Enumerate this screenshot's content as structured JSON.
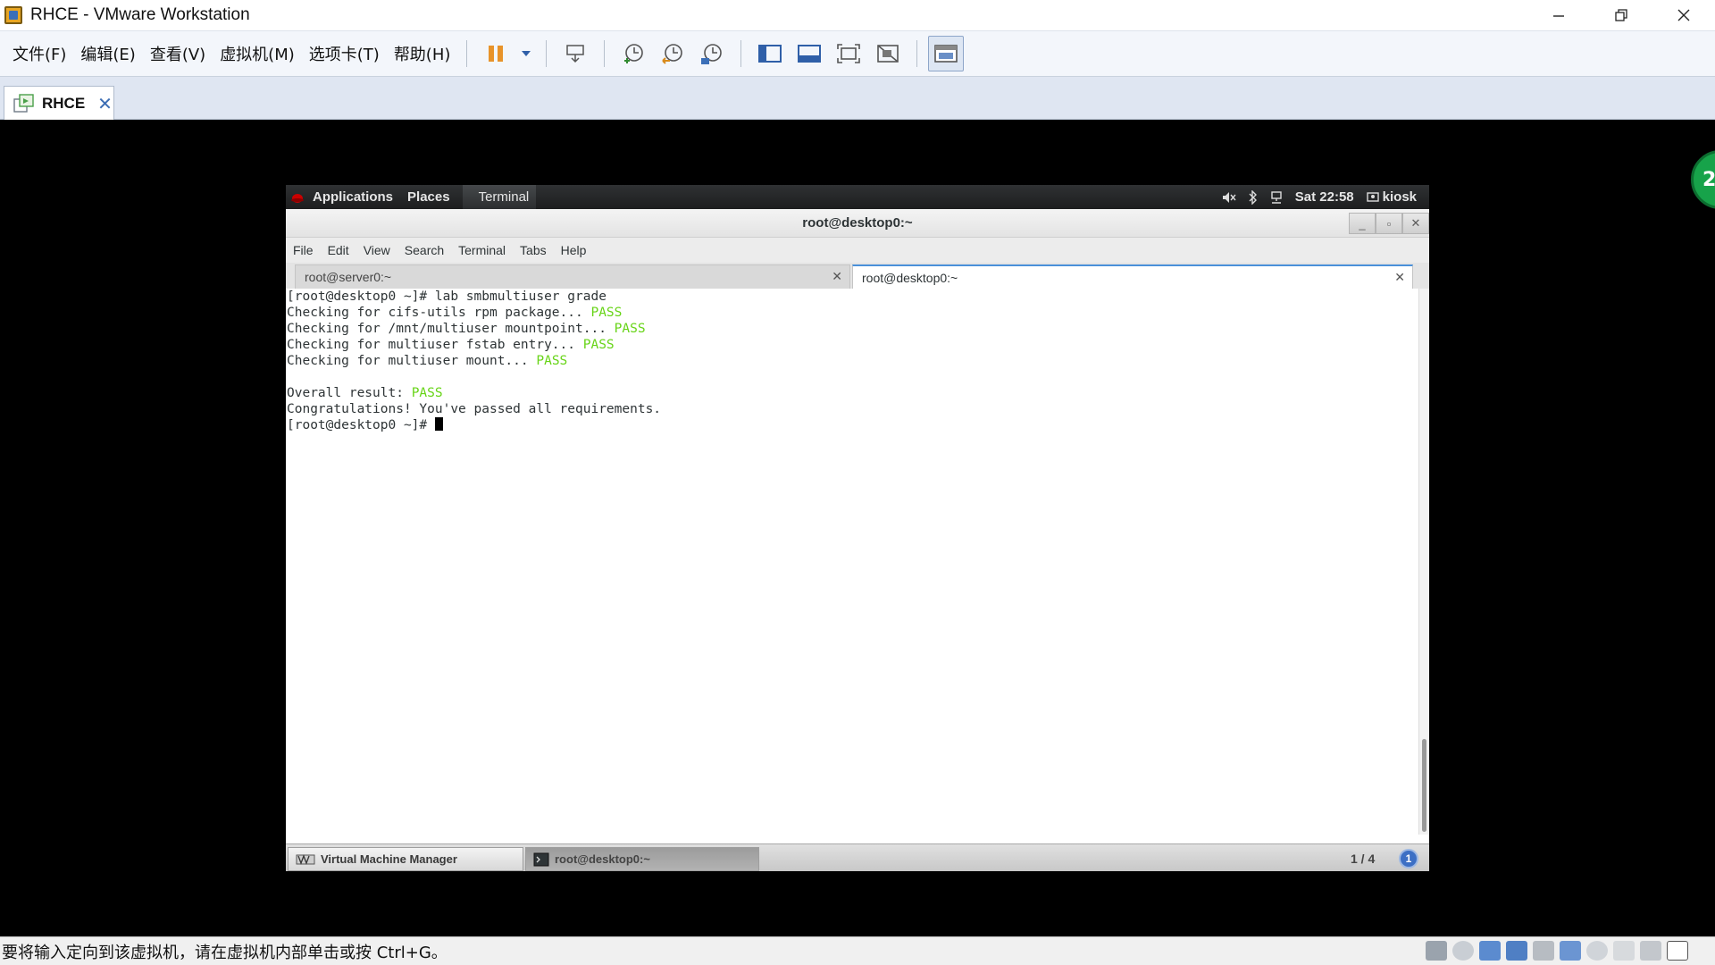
{
  "host": {
    "window_title": "RHCE - VMware Workstation",
    "menus": [
      "文件(F)",
      "编辑(E)",
      "查看(V)",
      "虚拟机(M)",
      "选项卡(T)",
      "帮助(H)"
    ],
    "tab_label": "RHCE",
    "status_text": "要将输入定向到该虚拟机，请在虚拟机内部单击或按 Ctrl+G。",
    "side_badge": "2"
  },
  "guest": {
    "topbar": {
      "applications": "Applications",
      "places": "Places",
      "terminal": "Terminal",
      "clock": "Sat 22:58",
      "user": "kiosk"
    },
    "terminal_window": {
      "title": "root@desktop0:~",
      "menus": [
        "File",
        "Edit",
        "View",
        "Search",
        "Terminal",
        "Tabs",
        "Help"
      ],
      "tabs": [
        "root@server0:~",
        "root@desktop0:~"
      ],
      "lines": [
        {
          "text": "[root@desktop0 ~]# lab smbmultiuser grade",
          "status": ""
        },
        {
          "text": "Checking for cifs-utils rpm package... ",
          "status": "PASS"
        },
        {
          "text": "Checking for /mnt/multiuser mountpoint... ",
          "status": "PASS"
        },
        {
          "text": "Checking for multiuser fstab entry... ",
          "status": "PASS"
        },
        {
          "text": "Checking for multiuser mount... ",
          "status": "PASS"
        },
        {
          "text": "",
          "status": ""
        },
        {
          "text": "Overall result: ",
          "status": "PASS"
        },
        {
          "text": "Congratulations! You've passed all requirements.",
          "status": ""
        }
      ],
      "prompt": "[root@desktop0 ~]# "
    },
    "taskbar": {
      "items": [
        "Virtual Machine Manager",
        "root@desktop0:~"
      ],
      "workspace": "1 / 4",
      "notification_count": "1"
    }
  },
  "colors": {
    "pass": "#67d417",
    "tab_accent": "#4a90d9"
  }
}
